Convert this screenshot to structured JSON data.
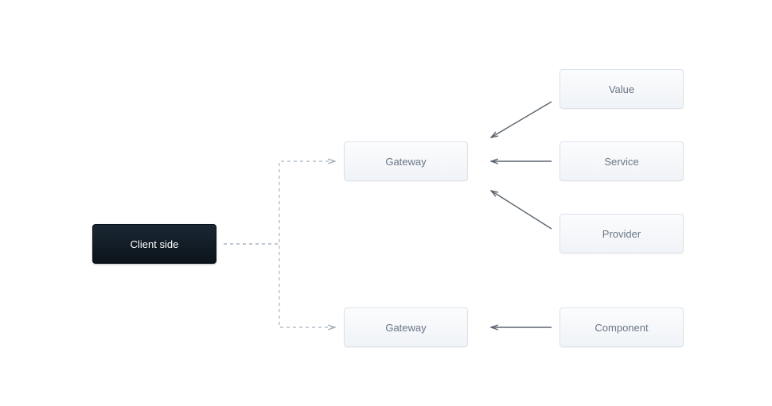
{
  "nodes": {
    "client": {
      "label": "Client side"
    },
    "gateway1": {
      "label": "Gateway"
    },
    "gateway2": {
      "label": "Gateway"
    },
    "value": {
      "label": "Value"
    },
    "service": {
      "label": "Service"
    },
    "provider": {
      "label": "Provider"
    },
    "component": {
      "label": "Component"
    }
  }
}
